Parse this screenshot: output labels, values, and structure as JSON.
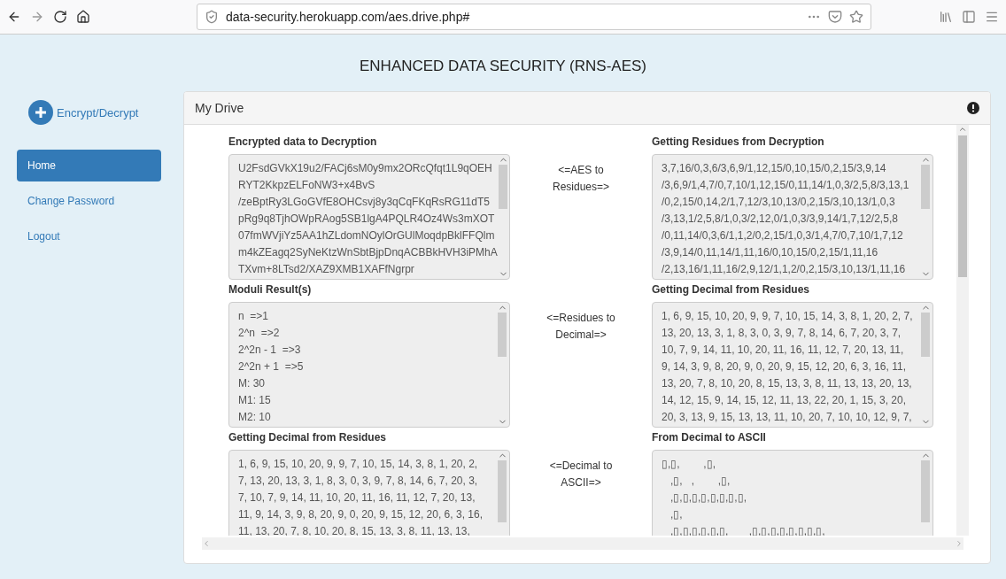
{
  "browser": {
    "url": "data-security.herokuapp.com/aes.drive.php#"
  },
  "page_title": "ENHANCED DATA SECURITY (RNS-AES)",
  "sidebar": {
    "action": "Encrypt/Decrypt",
    "items": [
      {
        "label": "Home",
        "selected": true
      },
      {
        "label": "Change Password",
        "selected": false
      },
      {
        "label": "Logout",
        "selected": false
      }
    ]
  },
  "panel": {
    "title": "My Drive",
    "rows": [
      {
        "left": {
          "label": "Encrypted data to Decryption",
          "lines": [
            "U2FsdGVkX19u2/FACj6sM0y9mx2ORcQfqt1L9qOEH",
            "RYT2KkpzELFoNW3+x4BvS",
            "/zeBptRy3LGoGVfE8OHCsvj8y3qCqFKqRsRG11dT5",
            "pRg9q8TjhOWpRAog5SB1lgA4PQLR4Oz4Ws3mXOT",
            "07fmWVjiYz5AA1hZLdomNOylOrGUlMoqdpBklFFQlm",
            "m4kZEagq2SyNeKtzWnSbtBjpDnqACBBkHVH3iPMhA",
            "TXvm+8LTsd2/XAZ9XMB1XAFfNgrpr"
          ]
        },
        "arrow": [
          "<=AES to",
          "Residues=>"
        ],
        "right": {
          "label": "Getting Residues from Decryption",
          "lines": [
            "3,7,16/0,3,6/3,6,9/1,12,15/0,10,15/0,2,15/3,9,14",
            "/3,6,9/1,4,7/0,7,10/1,12,15/0,11,14/1,0,3/2,5,8/3,13,1",
            "/0,2,15/0,14,2/1,7,12/3,10,13/0,2,15/3,10,13/1,0,3",
            "/3,13,1/2,5,8/1,0,3/2,12,0/1,0,3/3,9,14/1,7,12/2,5,8",
            "/0,11,14/0,3,6/1,1,2/0,2,15/1,0,3/1,4,7/0,7,10/1,7,12",
            "/3,9,14/0,11,14/1,11,16/0,10,15/0,2,15/1,11,16",
            "/2,13,16/1,11,16/2,9,12/1,1,2/0,2,15/3,10,13/1,11,16"
          ]
        }
      },
      {
        "left": {
          "label": "Moduli Result(s)",
          "lines": [
            "n  =>1",
            "2^n  =>2",
            "2^2n - 1  =>3",
            "2^2n + 1  =>5",
            "M: 30",
            "M1: 15",
            "M2: 10"
          ]
        },
        "arrow": [
          "<=Residues to",
          "Decimal=>"
        ],
        "right": {
          "label": "Getting Decimal from Residues",
          "lines": [
            "1, 6, 9, 15, 10, 20, 9, 9, 7, 10, 15, 14, 3, 8, 1, 20, 2, 7,",
            "13, 20, 13, 3, 1, 8, 3, 0, 3, 9, 7, 8, 14, 6, 7, 20, 3, 7,",
            "10, 7, 9, 14, 11, 10, 20, 11, 16, 11, 12, 7, 20, 13, 11,",
            "9, 14, 3, 9, 8, 20, 9, 0, 20, 9, 15, 12, 20, 6, 3, 16, 11,",
            "13, 20, 7, 8, 10, 20, 8, 15, 13, 3, 8, 11, 13, 13, 20, 13,",
            "14, 12, 15, 9, 14, 15, 12, 11, 13, 22, 20, 1, 15, 3, 20,",
            "20, 3, 13, 9, 15, 13, 13, 11, 10, 20, 7, 10, 10, 12, 9, 7,"
          ]
        }
      },
      {
        "left": {
          "label": "Getting Decimal from Residues",
          "lines": [
            "1, 6, 9, 15, 10, 20, 9, 9, 7, 10, 15, 14, 3, 8, 1, 20, 2,",
            "7, 13, 20, 13, 3, 1, 8, 3, 0, 3, 9, 7, 8, 14, 6, 7, 20, 3,",
            "7, 10, 7, 9, 14, 11, 10, 20, 11, 16, 11, 12, 7, 20, 13,",
            "11, 9, 14, 3, 9, 8, 20, 9, 0, 20, 9, 15, 12, 20, 6, 3, 16,",
            "11, 13, 20, 7, 8, 10, 20, 8, 15, 13, 3, 8, 11, 13, 13,"
          ]
        },
        "arrow": [
          "<=Decimal to",
          "ASCII=>"
        ],
        "right": {
          "label": "From Decimal to ASCII",
          "lines": [
            "▯,▯,        ,▯,",
            "   ,▯,   ,        ,▯,",
            "   ,▯,▯,▯,▯,▯,▯,▯,▯,",
            "   ,▯,",
            "   ,▯,▯,▯,▯,▯,▯,       ,▯,▯,▯,▯,▯,▯,▯,▯,"
          ]
        }
      }
    ]
  }
}
